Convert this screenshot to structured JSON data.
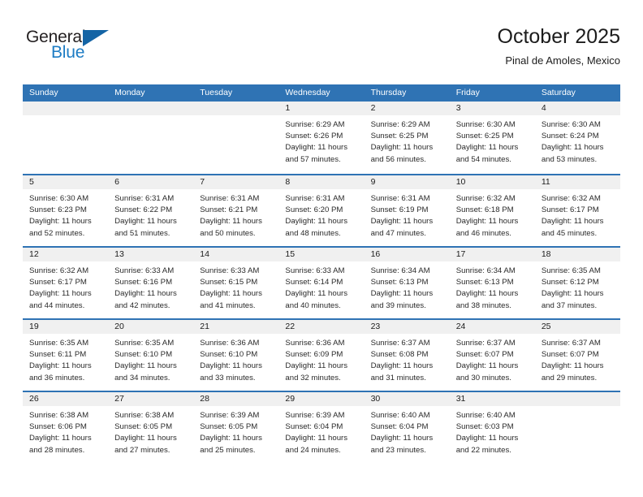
{
  "brand": {
    "name_part1": "General",
    "name_part2": "Blue",
    "triangle_color": "#1464a5",
    "blue_color": "#1d7cc4",
    "dark_color": "#231f20"
  },
  "header": {
    "title": "October 2025",
    "subtitle": "Pinal de Amoles, Mexico"
  },
  "theme": {
    "header_row_bg": "#2f73b4",
    "day_head_bg": "#f0f0f0",
    "row_divider": "#2f73b4"
  },
  "weekdays": [
    "Sunday",
    "Monday",
    "Tuesday",
    "Wednesday",
    "Thursday",
    "Friday",
    "Saturday"
  ],
  "weeks": [
    [
      {
        "date": "",
        "empty": true,
        "sunrise": "",
        "sunset": "",
        "daylight_line1": "",
        "daylight_line2": ""
      },
      {
        "date": "",
        "empty": true,
        "sunrise": "",
        "sunset": "",
        "daylight_line1": "",
        "daylight_line2": ""
      },
      {
        "date": "",
        "empty": true,
        "sunrise": "",
        "sunset": "",
        "daylight_line1": "",
        "daylight_line2": ""
      },
      {
        "date": "1",
        "empty": false,
        "sunrise": "Sunrise: 6:29 AM",
        "sunset": "Sunset: 6:26 PM",
        "daylight_line1": "Daylight: 11 hours",
        "daylight_line2": "and 57 minutes."
      },
      {
        "date": "2",
        "empty": false,
        "sunrise": "Sunrise: 6:29 AM",
        "sunset": "Sunset: 6:25 PM",
        "daylight_line1": "Daylight: 11 hours",
        "daylight_line2": "and 56 minutes."
      },
      {
        "date": "3",
        "empty": false,
        "sunrise": "Sunrise: 6:30 AM",
        "sunset": "Sunset: 6:25 PM",
        "daylight_line1": "Daylight: 11 hours",
        "daylight_line2": "and 54 minutes."
      },
      {
        "date": "4",
        "empty": false,
        "sunrise": "Sunrise: 6:30 AM",
        "sunset": "Sunset: 6:24 PM",
        "daylight_line1": "Daylight: 11 hours",
        "daylight_line2": "and 53 minutes."
      }
    ],
    [
      {
        "date": "5",
        "empty": false,
        "sunrise": "Sunrise: 6:30 AM",
        "sunset": "Sunset: 6:23 PM",
        "daylight_line1": "Daylight: 11 hours",
        "daylight_line2": "and 52 minutes."
      },
      {
        "date": "6",
        "empty": false,
        "sunrise": "Sunrise: 6:31 AM",
        "sunset": "Sunset: 6:22 PM",
        "daylight_line1": "Daylight: 11 hours",
        "daylight_line2": "and 51 minutes."
      },
      {
        "date": "7",
        "empty": false,
        "sunrise": "Sunrise: 6:31 AM",
        "sunset": "Sunset: 6:21 PM",
        "daylight_line1": "Daylight: 11 hours",
        "daylight_line2": "and 50 minutes."
      },
      {
        "date": "8",
        "empty": false,
        "sunrise": "Sunrise: 6:31 AM",
        "sunset": "Sunset: 6:20 PM",
        "daylight_line1": "Daylight: 11 hours",
        "daylight_line2": "and 48 minutes."
      },
      {
        "date": "9",
        "empty": false,
        "sunrise": "Sunrise: 6:31 AM",
        "sunset": "Sunset: 6:19 PM",
        "daylight_line1": "Daylight: 11 hours",
        "daylight_line2": "and 47 minutes."
      },
      {
        "date": "10",
        "empty": false,
        "sunrise": "Sunrise: 6:32 AM",
        "sunset": "Sunset: 6:18 PM",
        "daylight_line1": "Daylight: 11 hours",
        "daylight_line2": "and 46 minutes."
      },
      {
        "date": "11",
        "empty": false,
        "sunrise": "Sunrise: 6:32 AM",
        "sunset": "Sunset: 6:17 PM",
        "daylight_line1": "Daylight: 11 hours",
        "daylight_line2": "and 45 minutes."
      }
    ],
    [
      {
        "date": "12",
        "empty": false,
        "sunrise": "Sunrise: 6:32 AM",
        "sunset": "Sunset: 6:17 PM",
        "daylight_line1": "Daylight: 11 hours",
        "daylight_line2": "and 44 minutes."
      },
      {
        "date": "13",
        "empty": false,
        "sunrise": "Sunrise: 6:33 AM",
        "sunset": "Sunset: 6:16 PM",
        "daylight_line1": "Daylight: 11 hours",
        "daylight_line2": "and 42 minutes."
      },
      {
        "date": "14",
        "empty": false,
        "sunrise": "Sunrise: 6:33 AM",
        "sunset": "Sunset: 6:15 PM",
        "daylight_line1": "Daylight: 11 hours",
        "daylight_line2": "and 41 minutes."
      },
      {
        "date": "15",
        "empty": false,
        "sunrise": "Sunrise: 6:33 AM",
        "sunset": "Sunset: 6:14 PM",
        "daylight_line1": "Daylight: 11 hours",
        "daylight_line2": "and 40 minutes."
      },
      {
        "date": "16",
        "empty": false,
        "sunrise": "Sunrise: 6:34 AM",
        "sunset": "Sunset: 6:13 PM",
        "daylight_line1": "Daylight: 11 hours",
        "daylight_line2": "and 39 minutes."
      },
      {
        "date": "17",
        "empty": false,
        "sunrise": "Sunrise: 6:34 AM",
        "sunset": "Sunset: 6:13 PM",
        "daylight_line1": "Daylight: 11 hours",
        "daylight_line2": "and 38 minutes."
      },
      {
        "date": "18",
        "empty": false,
        "sunrise": "Sunrise: 6:35 AM",
        "sunset": "Sunset: 6:12 PM",
        "daylight_line1": "Daylight: 11 hours",
        "daylight_line2": "and 37 minutes."
      }
    ],
    [
      {
        "date": "19",
        "empty": false,
        "sunrise": "Sunrise: 6:35 AM",
        "sunset": "Sunset: 6:11 PM",
        "daylight_line1": "Daylight: 11 hours",
        "daylight_line2": "and 36 minutes."
      },
      {
        "date": "20",
        "empty": false,
        "sunrise": "Sunrise: 6:35 AM",
        "sunset": "Sunset: 6:10 PM",
        "daylight_line1": "Daylight: 11 hours",
        "daylight_line2": "and 34 minutes."
      },
      {
        "date": "21",
        "empty": false,
        "sunrise": "Sunrise: 6:36 AM",
        "sunset": "Sunset: 6:10 PM",
        "daylight_line1": "Daylight: 11 hours",
        "daylight_line2": "and 33 minutes."
      },
      {
        "date": "22",
        "empty": false,
        "sunrise": "Sunrise: 6:36 AM",
        "sunset": "Sunset: 6:09 PM",
        "daylight_line1": "Daylight: 11 hours",
        "daylight_line2": "and 32 minutes."
      },
      {
        "date": "23",
        "empty": false,
        "sunrise": "Sunrise: 6:37 AM",
        "sunset": "Sunset: 6:08 PM",
        "daylight_line1": "Daylight: 11 hours",
        "daylight_line2": "and 31 minutes."
      },
      {
        "date": "24",
        "empty": false,
        "sunrise": "Sunrise: 6:37 AM",
        "sunset": "Sunset: 6:07 PM",
        "daylight_line1": "Daylight: 11 hours",
        "daylight_line2": "and 30 minutes."
      },
      {
        "date": "25",
        "empty": false,
        "sunrise": "Sunrise: 6:37 AM",
        "sunset": "Sunset: 6:07 PM",
        "daylight_line1": "Daylight: 11 hours",
        "daylight_line2": "and 29 minutes."
      }
    ],
    [
      {
        "date": "26",
        "empty": false,
        "sunrise": "Sunrise: 6:38 AM",
        "sunset": "Sunset: 6:06 PM",
        "daylight_line1": "Daylight: 11 hours",
        "daylight_line2": "and 28 minutes."
      },
      {
        "date": "27",
        "empty": false,
        "sunrise": "Sunrise: 6:38 AM",
        "sunset": "Sunset: 6:05 PM",
        "daylight_line1": "Daylight: 11 hours",
        "daylight_line2": "and 27 minutes."
      },
      {
        "date": "28",
        "empty": false,
        "sunrise": "Sunrise: 6:39 AM",
        "sunset": "Sunset: 6:05 PM",
        "daylight_line1": "Daylight: 11 hours",
        "daylight_line2": "and 25 minutes."
      },
      {
        "date": "29",
        "empty": false,
        "sunrise": "Sunrise: 6:39 AM",
        "sunset": "Sunset: 6:04 PM",
        "daylight_line1": "Daylight: 11 hours",
        "daylight_line2": "and 24 minutes."
      },
      {
        "date": "30",
        "empty": false,
        "sunrise": "Sunrise: 6:40 AM",
        "sunset": "Sunset: 6:04 PM",
        "daylight_line1": "Daylight: 11 hours",
        "daylight_line2": "and 23 minutes."
      },
      {
        "date": "31",
        "empty": false,
        "sunrise": "Sunrise: 6:40 AM",
        "sunset": "Sunset: 6:03 PM",
        "daylight_line1": "Daylight: 11 hours",
        "daylight_line2": "and 22 minutes."
      },
      {
        "date": "",
        "empty": true,
        "sunrise": "",
        "sunset": "",
        "daylight_line1": "",
        "daylight_line2": ""
      }
    ]
  ]
}
